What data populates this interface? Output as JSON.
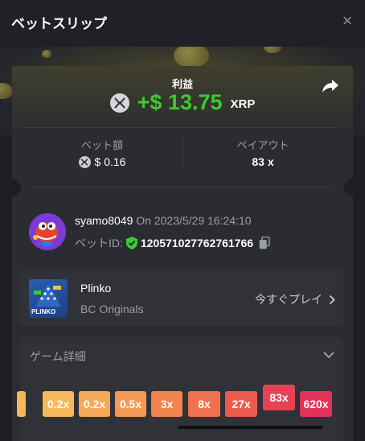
{
  "header": {
    "title": "ベットスリップ",
    "close_icon": "×"
  },
  "profit": {
    "label": "利益",
    "amount": "+$ 13.75",
    "currency": "XRP",
    "color": "#3dc933"
  },
  "bet": {
    "amount_label": "ベット額",
    "amount_value": "$ 0.16",
    "payout_label": "ペイアウト",
    "payout_value": "83 x"
  },
  "user": {
    "name": "syamo8049",
    "time": "On 2023/5/29 16:24:10",
    "bet_id_label": "ベットID:",
    "bet_id": "120571027762761766"
  },
  "game": {
    "name": "Plinko",
    "provider": "BC Originals",
    "play_label": "今すぐプレイ",
    "thumb_label": "PLINKO"
  },
  "details": {
    "title": "ゲーム詳細",
    "multipliers": [
      {
        "label": "",
        "color": "#f5b85a"
      },
      {
        "label": "0.2x",
        "color": "#f5b85a"
      },
      {
        "label": "0.2x",
        "color": "#f5a855"
      },
      {
        "label": "0.5x",
        "color": "#f39a52"
      },
      {
        "label": "3x",
        "color": "#f2844e"
      },
      {
        "label": "8x",
        "color": "#f0714b"
      },
      {
        "label": "27x",
        "color": "#ec5a4d"
      },
      {
        "label": "83x",
        "color": "#e84155",
        "active": true
      },
      {
        "label": "620x",
        "color": "#e3315a"
      }
    ]
  },
  "icons": {
    "share": "share-icon",
    "xrp": "xrp-icon",
    "shield": "shield-check-icon",
    "copy": "copy-icon",
    "chevron_right": "chevron-right-icon",
    "chevron_down": "chevron-down-icon"
  }
}
